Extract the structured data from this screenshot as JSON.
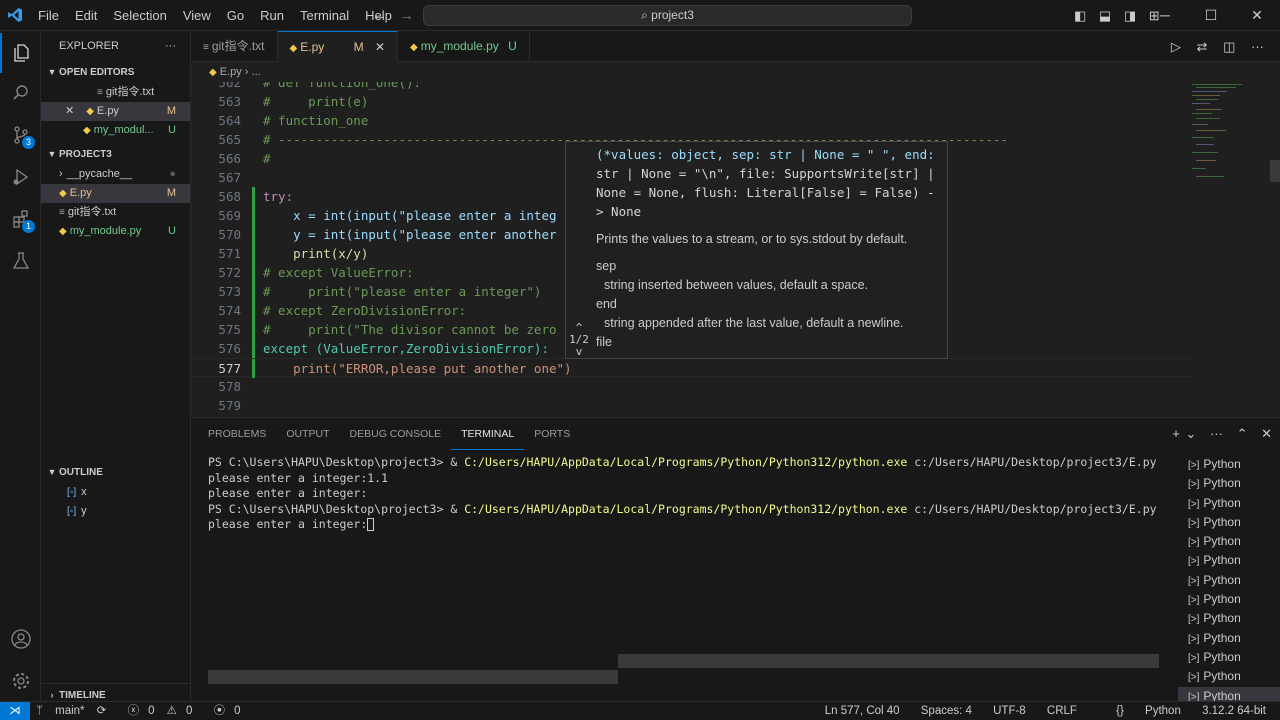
{
  "titlebar": {
    "menu": [
      "File",
      "Edit",
      "Selection",
      "View",
      "Go",
      "Run",
      "Terminal",
      "Help"
    ],
    "search_text": "project3"
  },
  "activity_bar": {
    "items": [
      "explorer-icon",
      "search-icon",
      "source-control-icon",
      "run-debug-icon",
      "extensions-icon",
      "testing-icon"
    ],
    "source_control_badge": "3",
    "extensions_badge": "1"
  },
  "sidebar": {
    "title": "EXPLORER",
    "open_editors": {
      "title": "OPEN EDITORS",
      "items": [
        {
          "name": "git指令.txt",
          "status": ""
        },
        {
          "name": "E.py",
          "status": "M"
        },
        {
          "name": "my_modul...",
          "status": "U"
        }
      ]
    },
    "project": {
      "title": "PROJECT3",
      "items": [
        {
          "name": "__pycache__",
          "status": ""
        },
        {
          "name": "E.py",
          "status": "M"
        },
        {
          "name": "git指令.txt",
          "status": ""
        },
        {
          "name": "my_module.py",
          "status": "U"
        }
      ]
    },
    "outline": {
      "title": "OUTLINE",
      "items": [
        "x",
        "y"
      ]
    },
    "timeline": {
      "title": "TIMELINE"
    }
  },
  "tabs": [
    {
      "name": "git指令.txt",
      "flag": ""
    },
    {
      "name": "E.py",
      "flag": "M"
    },
    {
      "name": "my_module.py",
      "flag": "U"
    }
  ],
  "breadcrumb": {
    "file": "E.py",
    "rest": "..."
  },
  "editor": {
    "lines": [
      {
        "n": "562",
        "text": "# def function_one():"
      },
      {
        "n": "563",
        "text": "#     print(e)"
      },
      {
        "n": "564",
        "text": "# function_one"
      },
      {
        "n": "565",
        "text": "# -------------------------------------------------------------------------------------------------"
      },
      {
        "n": "566",
        "text": "#"
      },
      {
        "n": "567",
        "text": ""
      },
      {
        "n": "568",
        "text": "try:"
      },
      {
        "n": "569",
        "text": "    x = int(input(\"please enter a integ"
      },
      {
        "n": "570",
        "text": "    y = int(input(\"please enter another"
      },
      {
        "n": "571",
        "text": "    print(x/y)"
      },
      {
        "n": "572",
        "text": "# except ValueError:"
      },
      {
        "n": "573",
        "text": "#     print(\"please enter a integer\")"
      },
      {
        "n": "574",
        "text": "# except ZeroDivisionError:"
      },
      {
        "n": "575",
        "text": "#     print(\"The divisor cannot be zero"
      },
      {
        "n": "576",
        "text": "except (ValueError,ZeroDivisionError):"
      },
      {
        "n": "577",
        "text": "    print(\"ERROR,please put another one\")"
      },
      {
        "n": "578",
        "text": ""
      },
      {
        "n": "579",
        "text": ""
      }
    ]
  },
  "hover": {
    "signature": [
      "(*values: object, sep: str | None = \" \", end:",
      "str | None = \"\\n\", file: SupportsWrite[str] |",
      "None = None, flush: Literal[False] = False) -",
      "> None"
    ],
    "pager": "1/2",
    "description": "Prints the values to a stream, or to sys.stdout by default.",
    "params": [
      {
        "name": "sep",
        "desc": "string inserted between values, default a space."
      },
      {
        "name": "end",
        "desc": "string appended after the last value, default a newline."
      },
      {
        "name": "file",
        "desc": ""
      }
    ]
  },
  "panel": {
    "tabs": [
      "PROBLEMS",
      "OUTPUT",
      "DEBUG CONSOLE",
      "TERMINAL",
      "PORTS"
    ],
    "active_tab": "TERMINAL",
    "terminal_lines": [
      {
        "prompt": "PS C:\\Users\\HAPU\\Desktop\\project3> & ",
        "exe": "C:/Users/HAPU/AppData/Local/Programs/Python/Python312/python.exe",
        "arg": " c:/Users/HAPU/Desktop/project3/E.py"
      },
      {
        "prompt": "please enter a integer:1.1",
        "exe": "",
        "arg": ""
      },
      {
        "prompt": "please enter a integer:",
        "exe": "",
        "arg": ""
      },
      {
        "prompt": "PS C:\\Users\\HAPU\\Desktop\\project3> & ",
        "exe": "C:/Users/HAPU/AppData/Local/Programs/Python/Python312/python.exe",
        "arg": " c:/Users/HAPU/Desktop/project3/E.py"
      }
    ],
    "last_line": "please enter a integer:",
    "terminal_instances": [
      "Python",
      "Python",
      "Python",
      "Python",
      "Python",
      "Python",
      "Python",
      "Python",
      "Python",
      "Python",
      "Python",
      "Python",
      "Python"
    ]
  },
  "statusbar": {
    "branch": "main*",
    "sync": "⟳",
    "errors": "0",
    "warnings": "0",
    "ports": "0",
    "position": "Ln 577, Col 40",
    "spaces": "Spaces: 4",
    "encoding": "UTF-8",
    "eol": "CRLF",
    "language": "Python",
    "interpreter": "3.12.2 64-bit"
  },
  "colors": {
    "accent": "#0078d4",
    "modified": "#e2c08d",
    "untracked": "#73c991",
    "background": "#1f1f1f"
  }
}
